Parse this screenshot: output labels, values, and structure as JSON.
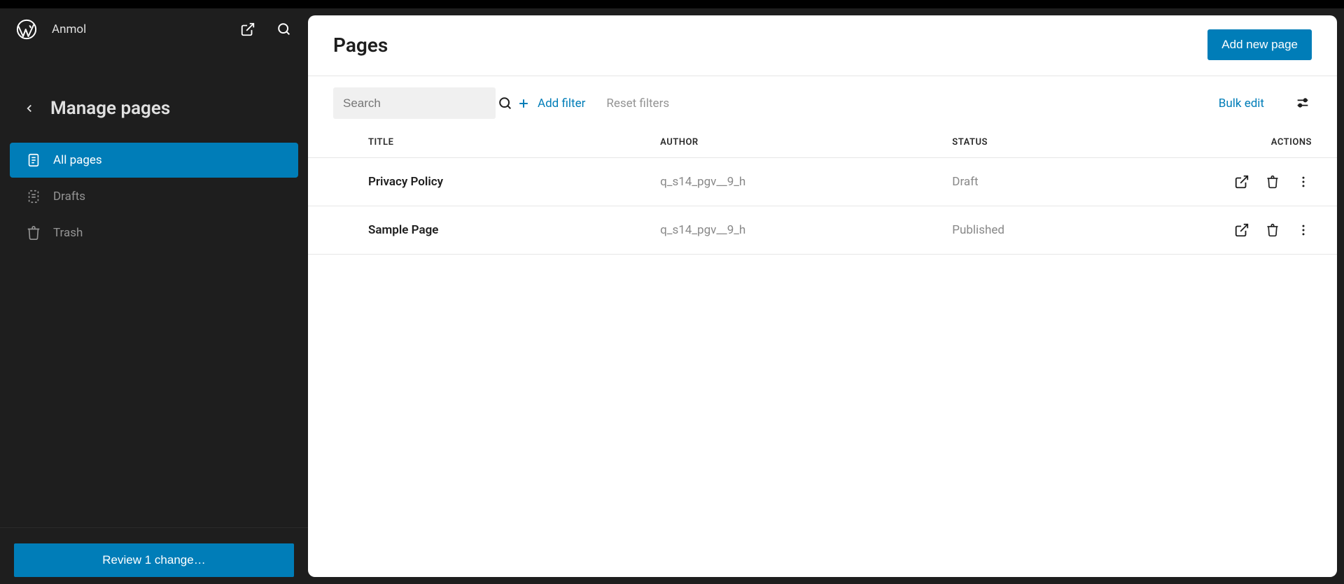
{
  "header": {
    "site_name": "Anmol"
  },
  "sidebar": {
    "title": "Manage pages",
    "items": [
      {
        "label": "All pages",
        "active": true
      },
      {
        "label": "Drafts",
        "active": false
      },
      {
        "label": "Trash",
        "active": false
      }
    ],
    "review_button": "Review 1 change…"
  },
  "panel": {
    "title": "Pages",
    "add_button": "Add new page",
    "search_placeholder": "Search",
    "add_filter": "Add filter",
    "reset_filters": "Reset filters",
    "bulk_edit": "Bulk edit"
  },
  "table": {
    "columns": {
      "title": "TITLE",
      "author": "AUTHOR",
      "status": "STATUS",
      "actions": "ACTIONS"
    },
    "rows": [
      {
        "title": "Privacy Policy",
        "author": "q_s14_pgv__9_h",
        "status": "Draft"
      },
      {
        "title": "Sample Page",
        "author": "q_s14_pgv__9_h",
        "status": "Published"
      }
    ]
  },
  "colors": {
    "accent": "#007db8",
    "sidebar_bg": "#1e1e1e"
  }
}
